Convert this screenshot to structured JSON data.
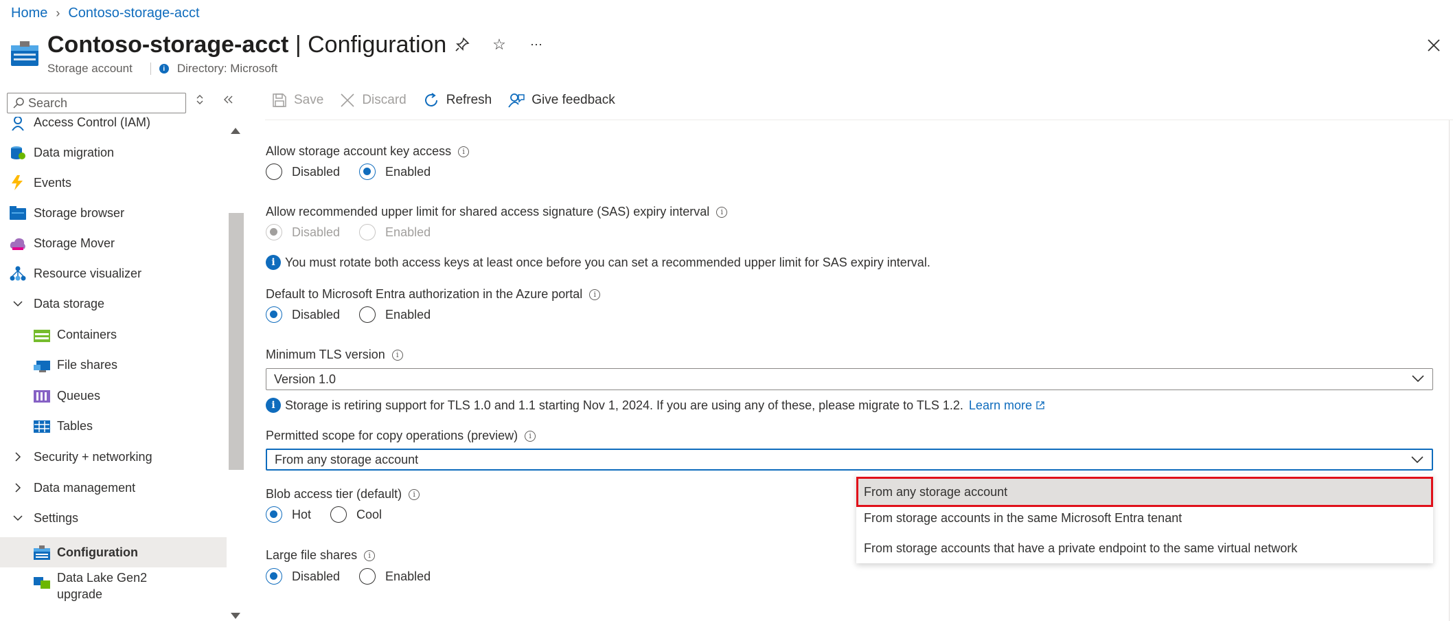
{
  "breadcrumb": {
    "home": "Home",
    "resource": "Contoso-storage-acct"
  },
  "header": {
    "title_bold": "Contoso-storage-acct",
    "title_rest": " | Configuration",
    "resource_type": "Storage account",
    "directory": "Directory: Microsoft"
  },
  "search": {
    "placeholder": "Search"
  },
  "sidebar": {
    "items": [
      {
        "label": "Access Control (IAM)",
        "icon": "people-icon"
      },
      {
        "label": "Data migration",
        "icon": "data-migration-icon"
      },
      {
        "label": "Events",
        "icon": "lightning-icon"
      },
      {
        "label": "Storage browser",
        "icon": "folder-icon"
      },
      {
        "label": "Storage Mover",
        "icon": "cloud-icon"
      },
      {
        "label": "Resource visualizer",
        "icon": "hierarchy-icon"
      },
      {
        "label": "Data storage",
        "icon": "chevron-down-icon"
      },
      {
        "label": "Containers",
        "icon": "container-icon"
      },
      {
        "label": "File shares",
        "icon": "file-share-icon"
      },
      {
        "label": "Queues",
        "icon": "queue-icon"
      },
      {
        "label": "Tables",
        "icon": "table-icon"
      },
      {
        "label": "Security + networking",
        "icon": "chevron-right-icon"
      },
      {
        "label": "Data management",
        "icon": "chevron-right-icon"
      },
      {
        "label": "Settings",
        "icon": "chevron-down-icon"
      },
      {
        "label": "Configuration",
        "icon": "configuration-icon"
      },
      {
        "label": "Data Lake Gen2",
        "label2": "upgrade",
        "icon": "data-lake-icon"
      }
    ]
  },
  "toolbar": {
    "save": "Save",
    "discard": "Discard",
    "refresh": "Refresh",
    "feedback": "Give feedback"
  },
  "settings": {
    "key_access": {
      "label": "Allow storage account key access",
      "disabled": "Disabled",
      "enabled": "Enabled",
      "value": "Enabled"
    },
    "sas_limit": {
      "label": "Allow recommended upper limit for shared access signature (SAS) expiry interval",
      "disabled": "Disabled",
      "enabled": "Enabled",
      "value": "Disabled"
    },
    "sas_message": "You must rotate both access keys at least once before you can set a recommended upper limit for SAS expiry interval.",
    "entra_default": {
      "label": "Default to Microsoft Entra authorization in the Azure portal",
      "disabled": "Disabled",
      "enabled": "Enabled",
      "value": "Disabled"
    },
    "tls": {
      "label": "Minimum TLS version",
      "value": "Version 1.0"
    },
    "tls_message": "Storage is retiring support for TLS 1.0 and 1.1 starting Nov 1, 2024. If you are using any of these, please migrate to TLS 1.2.",
    "tls_link": "Learn more",
    "copy_scope": {
      "label": "Permitted scope for copy operations (preview)",
      "value": "From any storage account",
      "options": [
        "From any storage account",
        "From storage accounts in the same Microsoft Entra tenant",
        "From storage accounts that have a private endpoint to the same virtual network"
      ]
    },
    "blob_tier": {
      "label": "Blob access tier (default)",
      "hot": "Hot",
      "cool": "Cool",
      "value": "Hot"
    },
    "large_files": {
      "label": "Large file shares",
      "disabled": "Disabled",
      "enabled": "Enabled",
      "value": "Disabled"
    }
  },
  "colors": {
    "accent": "#0f6cbd",
    "highlight_border": "#e0101a",
    "selected_bg": "#edebe9"
  }
}
